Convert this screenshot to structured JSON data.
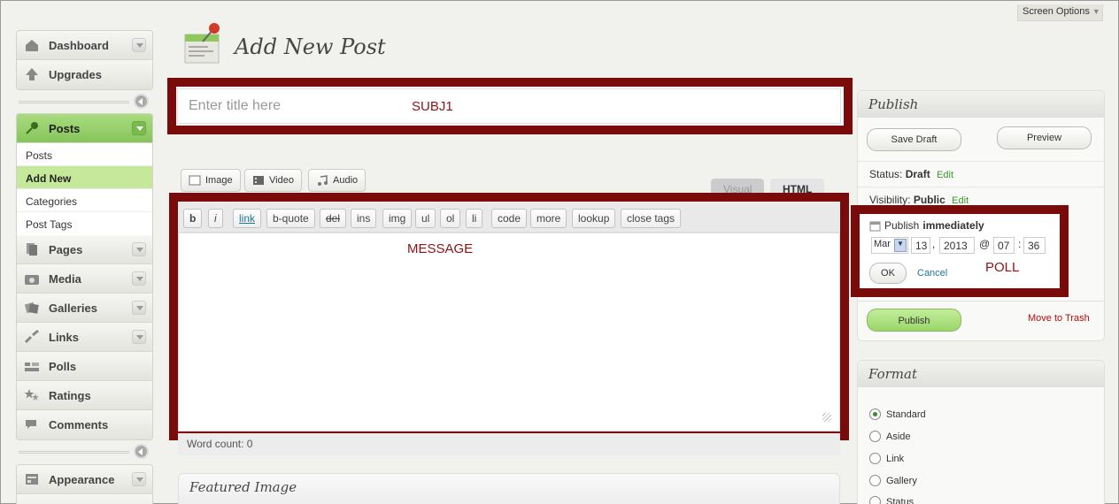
{
  "screen_options": {
    "label": "Screen Options"
  },
  "menu": {
    "top": [
      {
        "label": "Dashboard",
        "icon": "dashboard-icon"
      },
      {
        "label": "Upgrades",
        "icon": "upgrades-icon"
      }
    ],
    "posts": {
      "label": "Posts",
      "submenu": [
        "Posts",
        "Add New",
        "Categories",
        "Post Tags"
      ],
      "current": "Add New"
    },
    "middle": [
      {
        "label": "Pages",
        "icon": "pages-icon"
      },
      {
        "label": "Media",
        "icon": "media-icon"
      },
      {
        "label": "Galleries",
        "icon": "galleries-icon"
      },
      {
        "label": "Links",
        "icon": "links-icon"
      },
      {
        "label": "Polls",
        "icon": "polls-icon"
      },
      {
        "label": "Ratings",
        "icon": "ratings-icon"
      },
      {
        "label": "Comments",
        "icon": "comments-icon"
      }
    ],
    "bottom": [
      {
        "label": "Appearance",
        "icon": "appearance-icon"
      }
    ]
  },
  "page": {
    "title": "Add New Post"
  },
  "title_field": {
    "placeholder": "Enter title here",
    "highlight_label": "SUBJ1"
  },
  "media_buttons": [
    {
      "label": "Image",
      "icon": "image-icon"
    },
    {
      "label": "Video",
      "icon": "video-icon"
    },
    {
      "label": "Audio",
      "icon": "audio-icon"
    }
  ],
  "editor": {
    "tabs": {
      "visual": "Visual",
      "html": "HTML"
    },
    "quicktags": [
      "b",
      "i",
      "link",
      "b-quote",
      "del",
      "ins",
      "img",
      "ul",
      "ol",
      "li",
      "code",
      "more",
      "lookup",
      "close tags"
    ],
    "highlight_label": "MESSAGE",
    "word_count": "Word count: 0"
  },
  "featured_image": {
    "title": "Featured Image"
  },
  "publish": {
    "title": "Publish",
    "save_draft": "Save Draft",
    "preview": "Preview",
    "status_label": "Status:",
    "status_value": "Draft",
    "visibility_label": "Visibility:",
    "visibility_value": "Public",
    "edit": "Edit",
    "schedule_label": "Publish",
    "schedule_value": "immediately",
    "month": "Mar",
    "day": "13",
    "year": "2013",
    "at": "@",
    "hour": "07",
    "colon": ":",
    "minute": "36",
    "comma": ",",
    "ok": "OK",
    "cancel": "Cancel",
    "highlight_label": "POLL",
    "publish_button": "Publish",
    "trash": "Move to Trash"
  },
  "format": {
    "title": "Format",
    "options": [
      "Standard",
      "Aside",
      "Link",
      "Gallery",
      "Status"
    ],
    "selected": "Standard"
  },
  "colors": {
    "highlight": "#7a0b0b",
    "label": "#8b1414",
    "active_menu": "#86c55a",
    "link": "#21759b"
  }
}
